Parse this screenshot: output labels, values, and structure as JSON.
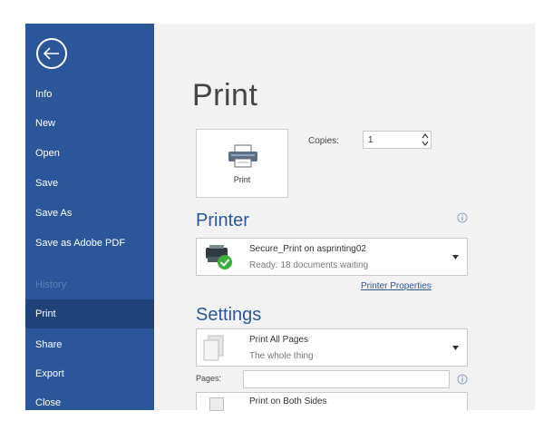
{
  "sidebar": {
    "items": [
      {
        "label": "Info"
      },
      {
        "label": "New"
      },
      {
        "label": "Open"
      },
      {
        "label": "Save"
      },
      {
        "label": "Save As"
      },
      {
        "label": "Save as Adobe PDF"
      },
      {
        "label": "History"
      },
      {
        "label": "Print"
      },
      {
        "label": "Share"
      },
      {
        "label": "Export"
      },
      {
        "label": "Close"
      }
    ],
    "selected": "Print"
  },
  "main": {
    "title": "Print",
    "print_button_label": "Print",
    "copies": {
      "label": "Copies:",
      "value": "1"
    },
    "printer": {
      "section_title": "Printer",
      "name": "Secure_Print on asprinting02",
      "status": "Ready: 18 documents waiting",
      "properties_link": "Printer Properties"
    },
    "settings": {
      "section_title": "Settings",
      "pages_option": {
        "title": "Print All Pages",
        "subtitle": "The whole thing"
      },
      "pages_label": "Pages:",
      "pages_value": "",
      "sides_option": {
        "title": "Print on Both Sides"
      }
    }
  },
  "colors": {
    "sidebar_bg": "#2b579a",
    "sidebar_selected": "#1f4378",
    "content_bg": "#f2f2f2",
    "accent": "#2b579a"
  },
  "icons": {
    "back": "arrow-left-circle-icon",
    "printer": "printer-icon",
    "printer_ready": "printer-ready-icon",
    "info": "info-icon",
    "pages": "document-pages-icon",
    "sides": "duplex-icon",
    "dropdown": "chevron-down-icon"
  }
}
